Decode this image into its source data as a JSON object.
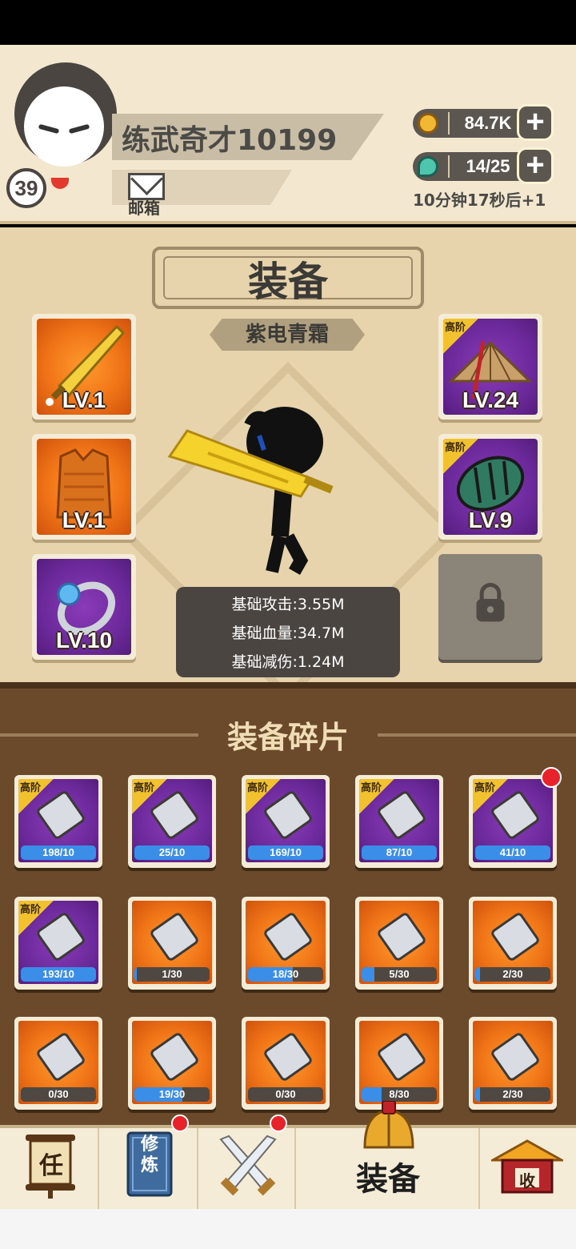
{
  "player": {
    "name": "练武奇才10199",
    "level": "39",
    "mail_label": "邮箱"
  },
  "resources": {
    "coins": "84.7K",
    "gems": "14/25",
    "timer": "10分钟17秒后+1"
  },
  "equip": {
    "title": "装备",
    "weapon_name": "紫电青霜",
    "slots": [
      {
        "name": "sword",
        "level": "LV.1",
        "tier": ""
      },
      {
        "name": "armor",
        "level": "LV.1",
        "tier": ""
      },
      {
        "name": "ring",
        "level": "LV.10",
        "tier": ""
      },
      {
        "name": "hat",
        "level": "LV.24",
        "tier": "高阶"
      },
      {
        "name": "bracer",
        "level": "LV.9",
        "tier": "高阶"
      }
    ],
    "stats": [
      "基础攻击:3.55M",
      "基础血量:34.7M",
      "基础减伤:1.24M"
    ]
  },
  "fragments": {
    "title": "装备碎片",
    "items": [
      {
        "count": "198/10",
        "tier": "高阶",
        "fill": 1.0
      },
      {
        "count": "25/10",
        "tier": "高阶",
        "fill": 1.0
      },
      {
        "count": "169/10",
        "tier": "高阶",
        "fill": 1.0
      },
      {
        "count": "87/10",
        "tier": "高阶",
        "fill": 1.0
      },
      {
        "count": "41/10",
        "tier": "高阶",
        "fill": 1.0
      },
      {
        "count": "193/10",
        "tier": "高阶",
        "fill": 1.0
      },
      {
        "count": "1/30",
        "tier": "",
        "fill": 0.033
      },
      {
        "count": "18/30",
        "tier": "",
        "fill": 0.6
      },
      {
        "count": "5/30",
        "tier": "",
        "fill": 0.167
      },
      {
        "count": "2/30",
        "tier": "",
        "fill": 0.067
      },
      {
        "count": "0/30",
        "tier": "",
        "fill": 0.0
      },
      {
        "count": "19/30",
        "tier": "",
        "fill": 0.633
      },
      {
        "count": "0/30",
        "tier": "",
        "fill": 0.0
      },
      {
        "count": "8/30",
        "tier": "",
        "fill": 0.267
      },
      {
        "count": "2/30",
        "tier": "",
        "fill": 0.067
      }
    ]
  },
  "nav": {
    "task_glyph": "任",
    "train_glyph": "修炼",
    "collect_glyph": "收",
    "active_label": "装备"
  }
}
